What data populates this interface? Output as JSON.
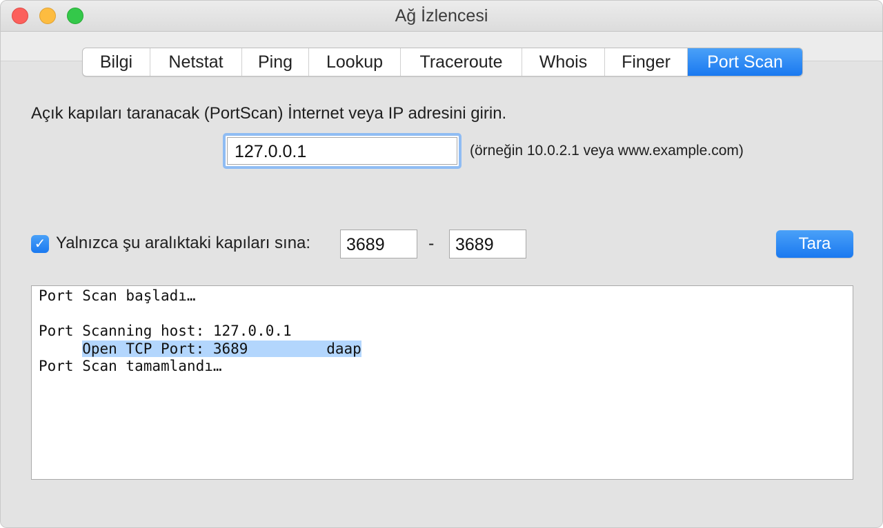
{
  "window": {
    "title": "Ağ İzlencesi"
  },
  "tabs": [
    "Bilgi",
    "Netstat",
    "Ping",
    "Lookup",
    "Traceroute",
    "Whois",
    "Finger",
    "Port Scan"
  ],
  "active_tab": "Port Scan",
  "form": {
    "instruction": "Açık kapıları taranacak (PortScan) İnternet veya IP adresini girin.",
    "host_value": "127.0.0.1",
    "host_hint": "(örneğin 10.0.2.1 veya www.example.com)",
    "range_checkbox_checked": true,
    "range_label": "Yalnızca şu aralıktaki kapıları sına:",
    "port_from": "3689",
    "range_separator": "-",
    "port_to": "3689",
    "scan_button": "Tara"
  },
  "output": {
    "lines": [
      "Port Scan başladı…",
      "",
      "Port Scanning host: 127.0.0.1",
      "     Open TCP Port: 3689         daap",
      "Port Scan tamamlandı…"
    ],
    "highlighted_line": 3
  },
  "colors": {
    "accent": "#1a79f0",
    "selection": "#b3d6fd"
  }
}
